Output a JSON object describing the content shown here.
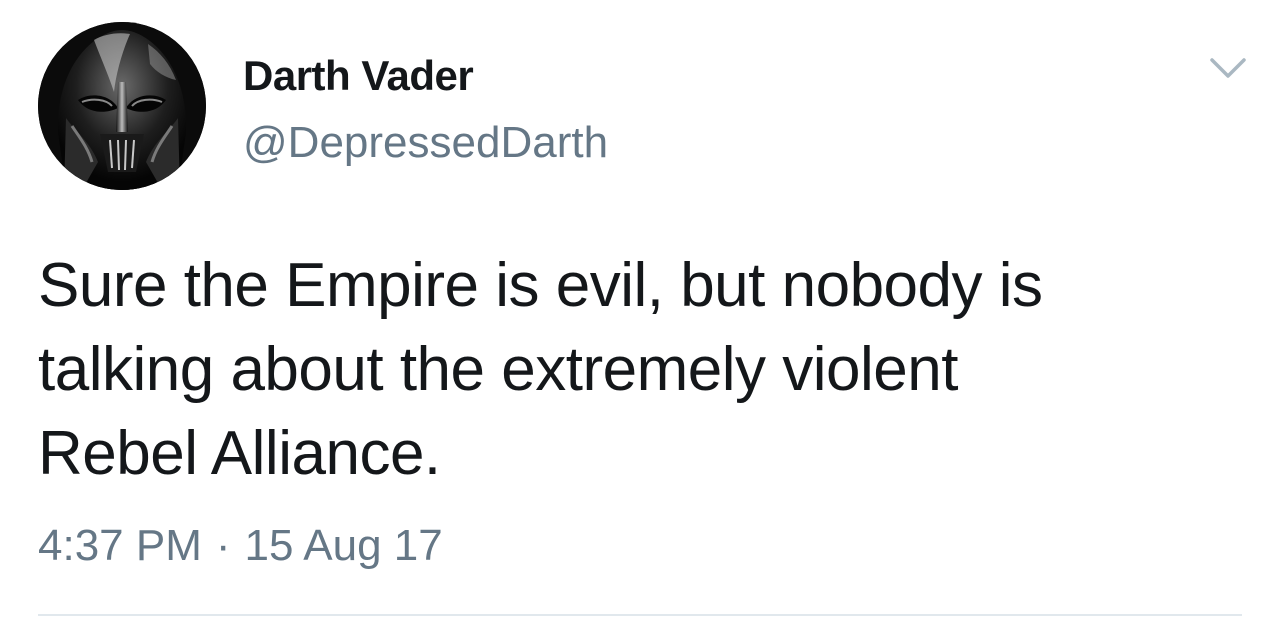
{
  "user": {
    "display_name": "Darth Vader",
    "handle": "@DepressedDarth",
    "avatar_icon": "darth-vader-helmet-icon"
  },
  "menu": {
    "icon": "chevron-down-icon"
  },
  "tweet": {
    "lines": [
      "Sure the Empire is evil, but nobody is",
      "talking about the extremely violent",
      "Rebel Alliance."
    ],
    "time": "4:37 PM",
    "separator": "·",
    "date": "15 Aug 17"
  },
  "colors": {
    "text": "#14171a",
    "secondary": "#657786",
    "divider": "#e1e8ed",
    "background": "#ffffff"
  }
}
